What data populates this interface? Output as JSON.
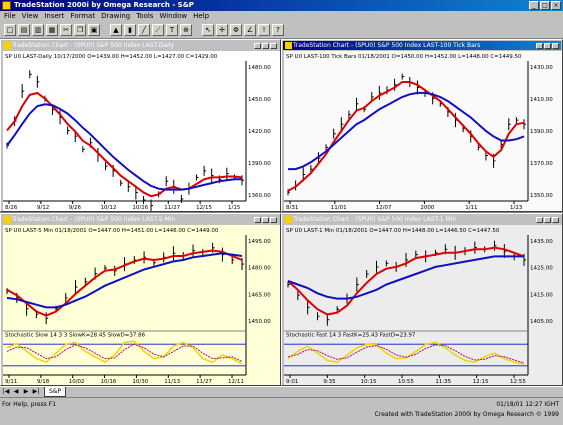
{
  "app": {
    "title": "TradeStation 2000i by Omega Research - S&P",
    "window_buttons": [
      "_",
      "□",
      "×"
    ]
  },
  "menu": [
    "File",
    "View",
    "Insert",
    "Format",
    "Drawing",
    "Tools",
    "Window",
    "Help"
  ],
  "toolbar_icons": [
    "new-icon",
    "open-icon",
    "save-icon",
    "print-icon",
    "cut-icon",
    "copy-icon",
    "paste-icon",
    "chart-icon",
    "bar-icon",
    "line-icon",
    "trendline-icon",
    "text-icon",
    "zoom-icon",
    "pointer-icon",
    "cross-icon",
    "fib-icon",
    "gann-icon",
    "alert-icon",
    "help-icon"
  ],
  "colors": {
    "price": "#000000",
    "avg_fast": "#e00000",
    "avg_slow": "#1010c0",
    "stoch_fast": "#e8d800",
    "stoch_slow": "#c00060",
    "bg_white": "#ffffff",
    "bg_yellow": "#ffffd8",
    "bg_gray": "#ececec"
  },
  "charts": [
    {
      "title": "TradeStation Chart - (SPU0) S&P 500 Index LAST-Daily",
      "header": "SP U0 LAST-Daily 10/17/2000   O=1439.00  H=1452.00  L=1427.00  C=1429.00",
      "y_ticks": [
        "1480.00",
        "1450.00",
        "1420.00",
        "1390.00",
        "1360.00"
      ],
      "x_ticks": [
        "8/26",
        "9/12",
        "9/26",
        "10/12",
        "10/26",
        "11/27",
        "12/15",
        "1/15"
      ],
      "active": false,
      "background": "#ffffff",
      "has_stochastic": false,
      "chart_data": {
        "type": "line",
        "series": [
          {
            "values": [
              1402,
              1428,
              1460,
              1478,
              1470,
              1452,
              1440,
              1432,
              1418,
              1412,
              1398,
              1405,
              1392,
              1380,
              1375,
              1362,
              1358,
              1352,
              1344,
              1338,
              1350,
              1364,
              1358,
              1345,
              1356,
              1368,
              1375,
              1370,
              1366,
              1372,
              1368,
              1365
            ]
          },
          {
            "values": [
              1418,
              1428,
              1444,
              1456,
              1458,
              1452,
              1444,
              1435,
              1425,
              1417,
              1407,
              1402,
              1394,
              1386,
              1378,
              1370,
              1364,
              1358,
              1352,
              1348,
              1350,
              1356,
              1358,
              1355,
              1356,
              1361,
              1366,
              1368,
              1368,
              1369,
              1369,
              1368
            ]
          },
          {
            "values": [
              1402,
              1413,
              1425,
              1436,
              1444,
              1446,
              1445,
              1441,
              1436,
              1429,
              1421,
              1414,
              1406,
              1398,
              1390,
              1383,
              1376,
              1370,
              1364,
              1359,
              1356,
              1355,
              1355,
              1355,
              1356,
              1358,
              1360,
              1362,
              1364,
              1365,
              1366,
              1366
            ]
          }
        ],
        "ylim": [
          1345,
          1490
        ]
      }
    },
    {
      "title": "TradeStation Chart - (SPU0) S&P 500 Index LAST-100 Tick Bars",
      "header": "SP U0 LAST-100 Tick Bars 01/18/2001   O=1450.00  H=1452.00  L=1448.00  C=1449.50",
      "y_ticks": [
        "1430.00",
        "1410.00",
        "1390.00",
        "1370.00",
        "1350.00"
      ],
      "x_ticks": [
        "8/31",
        "11/01",
        "12/07",
        "2000",
        "1/11",
        "1/23"
      ],
      "active": true,
      "background": "#fafafa",
      "has_stochastic": false,
      "chart_data": {
        "type": "line",
        "series": [
          {
            "values": [
              1345,
              1350,
              1358,
              1362,
              1370,
              1378,
              1388,
              1395,
              1402,
              1410,
              1406,
              1415,
              1418,
              1420,
              1424,
              1430,
              1426,
              1422,
              1418,
              1414,
              1410,
              1404,
              1398,
              1392,
              1386,
              1378,
              1372,
              1368,
              1380,
              1395,
              1398,
              1395
            ]
          },
          {
            "values": [
              1346,
              1349,
              1354,
              1359,
              1366,
              1373,
              1382,
              1390,
              1398,
              1405,
              1407,
              1412,
              1416,
              1419,
              1422,
              1426,
              1426,
              1424,
              1420,
              1416,
              1412,
              1406,
              1400,
              1394,
              1388,
              1381,
              1375,
              1371,
              1376,
              1388,
              1395,
              1396
            ]
          },
          {
            "values": [
              1362,
              1362,
              1364,
              1367,
              1371,
              1375,
              1380,
              1385,
              1390,
              1395,
              1398,
              1402,
              1406,
              1409,
              1412,
              1415,
              1417,
              1418,
              1418,
              1417,
              1415,
              1412,
              1408,
              1404,
              1400,
              1395,
              1390,
              1386,
              1383,
              1383,
              1384,
              1386
            ]
          }
        ],
        "ylim": [
          1340,
          1440
        ]
      }
    },
    {
      "title": "TradeStation Chart - (SPU0) S&P 500 Index LAST-5 Min",
      "header": "SP U0 LAST-5 Min 01/18/2001   O=1447.00  H=1451.00  L=1446.00  C=1449.00",
      "y_ticks": [
        "1495.00",
        "1480.00",
        "1465.00",
        "1450.00"
      ],
      "x_ticks": [
        "9/11",
        "9/18",
        "10/02",
        "10/16",
        "10/30",
        "11/13",
        "11/27",
        "12/11"
      ],
      "active": false,
      "background": "#ffffd8",
      "has_stochastic": true,
      "stoch_label": "Stochastic Slow 14 3 3   SlowK=28.45   SlowD=37.86",
      "chart_data": {
        "type": "line",
        "series": [
          {
            "values": [
              1465,
              1460,
              1452,
              1448,
              1445,
              1452,
              1460,
              1468,
              1472,
              1478,
              1482,
              1480,
              1485,
              1488,
              1490,
              1486,
              1490,
              1493,
              1491,
              1495,
              1494,
              1497,
              1492,
              1488,
              1485
            ]
          },
          {
            "values": [
              1466,
              1462,
              1456,
              1450,
              1447,
              1450,
              1456,
              1463,
              1469,
              1475,
              1480,
              1481,
              1484,
              1487,
              1489,
              1488,
              1489,
              1491,
              1491,
              1493,
              1494,
              1495,
              1494,
              1491,
              1488
            ]
          },
          {
            "values": [
              1460,
              1459,
              1457,
              1455,
              1453,
              1453,
              1455,
              1458,
              1461,
              1465,
              1469,
              1472,
              1475,
              1478,
              1481,
              1483,
              1485,
              1487,
              1488,
              1490,
              1491,
              1492,
              1493,
              1492,
              1491
            ]
          }
        ],
        "ylim": [
          1440,
          1505
        ],
        "stoch": {
          "fast": [
            70,
            82,
            60,
            40,
            30,
            55,
            80,
            85,
            60,
            45,
            30,
            50,
            85,
            88,
            60,
            40,
            45,
            75,
            85,
            70,
            40,
            30,
            50,
            40,
            25
          ],
          "slow": [
            60,
            72,
            70,
            55,
            40,
            45,
            65,
            78,
            70,
            55,
            40,
            42,
            65,
            80,
            70,
            52,
            45,
            60,
            75,
            75,
            55,
            40,
            42,
            45,
            32
          ]
        }
      }
    },
    {
      "title": "TradeStation Chart - (SPU0) S&P 500 Index LAST-1 Min",
      "header": "SP U0 LAST-1 Min 01/18/2001   O=1447.00  H=1448.00  L=1446.50  C=1447.50",
      "y_ticks": [
        "1435.00",
        "1425.00",
        "1415.00",
        "1405.00"
      ],
      "x_ticks": [
        "9:01",
        "9:35",
        "10:15",
        "10:55",
        "11:35",
        "12:15",
        "12:55"
      ],
      "active": false,
      "background": "#ececec",
      "has_stochastic": true,
      "stoch_label": "Stochastic Fast 14 3   FastK=25.43   FastD=23.97",
      "chart_data": {
        "type": "line",
        "series": [
          {
            "values": [
              1418,
              1412,
              1405,
              1400,
              1398,
              1404,
              1410,
              1418,
              1424,
              1428,
              1430,
              1428,
              1432,
              1435,
              1434,
              1436,
              1438,
              1436,
              1437,
              1439,
              1438,
              1440,
              1437,
              1434,
              1432
            ]
          },
          {
            "values": [
              1420,
              1415,
              1409,
              1404,
              1401,
              1402,
              1406,
              1413,
              1419,
              1424,
              1427,
              1428,
              1430,
              1433,
              1434,
              1435,
              1436,
              1436,
              1437,
              1438,
              1438,
              1439,
              1438,
              1436,
              1434
            ]
          },
          {
            "values": [
              1420,
              1418,
              1416,
              1413,
              1411,
              1410,
              1410,
              1411,
              1413,
              1415,
              1418,
              1420,
              1422,
              1424,
              1426,
              1428,
              1429,
              1430,
              1431,
              1432,
              1433,
              1434,
              1434,
              1434,
              1434
            ]
          }
        ],
        "ylim": [
          1395,
          1445
        ],
        "stoch": {
          "fast": [
            40,
            60,
            75,
            55,
            35,
            30,
            50,
            70,
            80,
            78,
            55,
            40,
            42,
            60,
            80,
            85,
            70,
            50,
            35,
            30,
            45,
            55,
            40,
            30,
            25
          ],
          "slow": [
            45,
            52,
            65,
            62,
            48,
            38,
            42,
            58,
            72,
            76,
            66,
            50,
            44,
            52,
            68,
            78,
            76,
            62,
            46,
            36,
            38,
            48,
            45,
            36,
            28
          ]
        }
      }
    }
  ],
  "sheet_tab": "S&P",
  "status": {
    "help": "For Help, press F1",
    "time": "01/18/01 12:27 IGHT",
    "credit": "Created with TradeStation 2000i by Omega Research © 1999"
  }
}
